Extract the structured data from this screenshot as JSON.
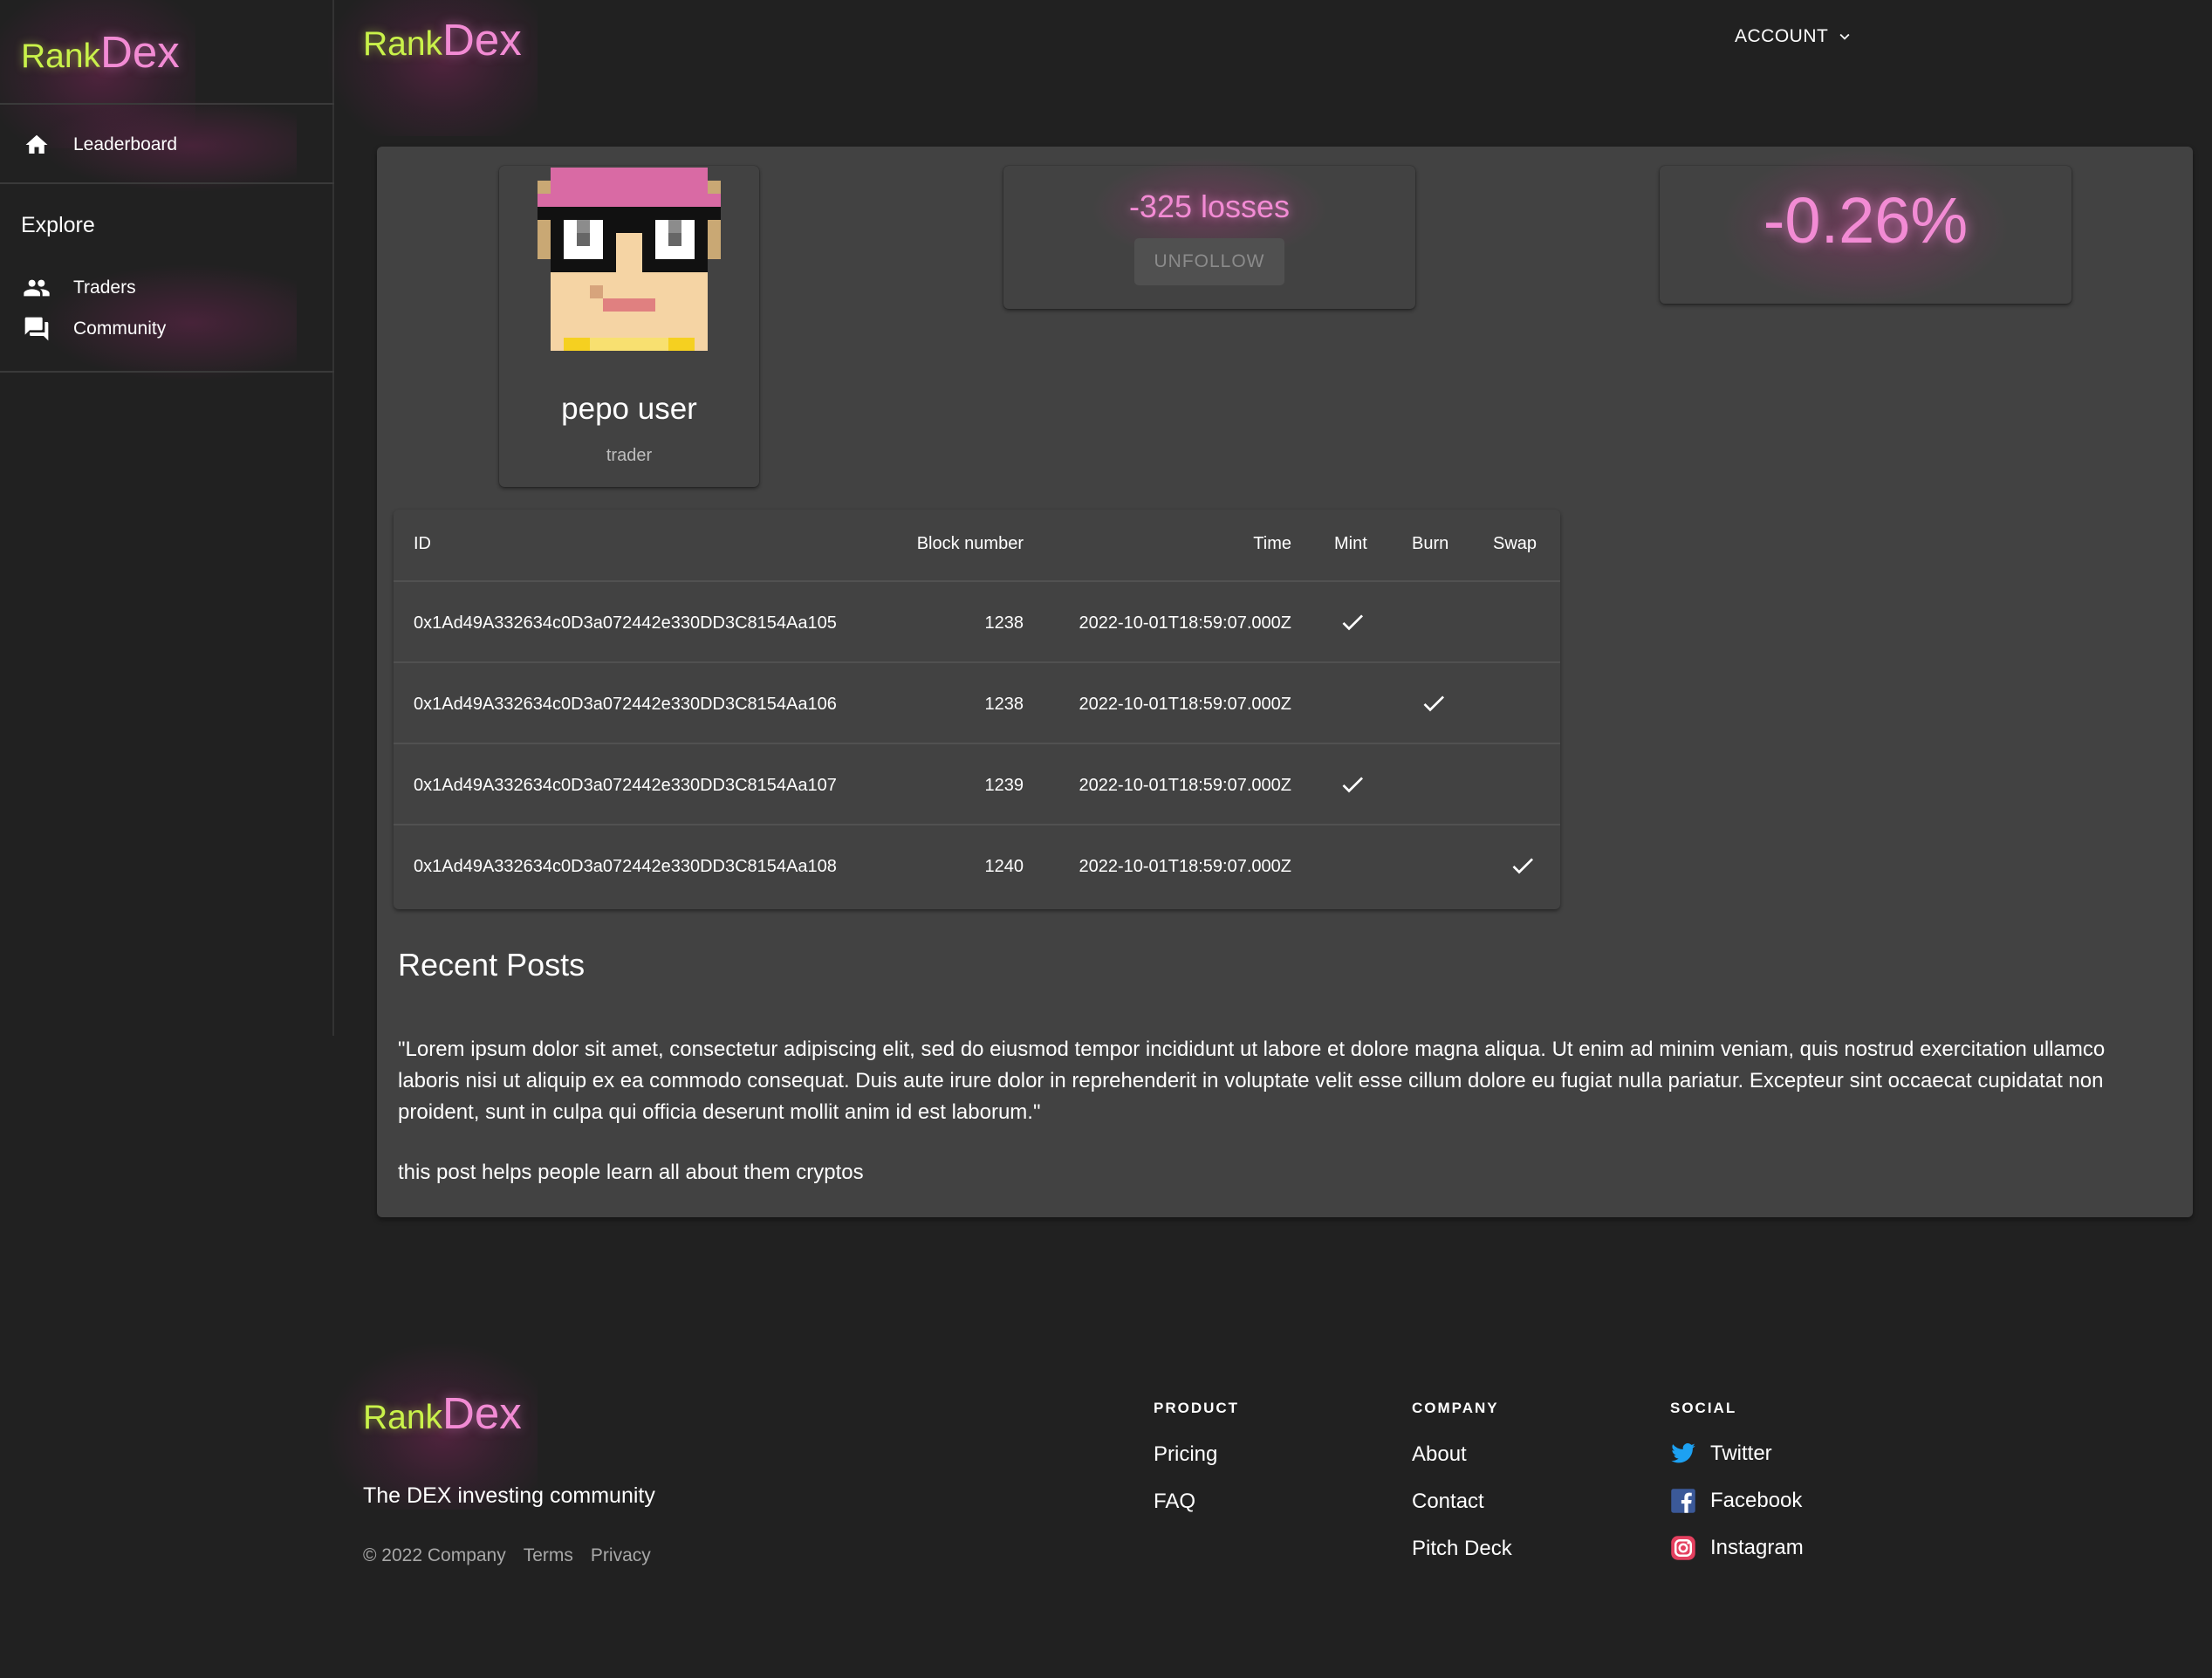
{
  "brand": {
    "rank": "Rank",
    "dex": "Dex"
  },
  "sidebar": {
    "items": [
      {
        "label": "Leaderboard",
        "icon": "home-icon"
      }
    ],
    "explore_title": "Explore",
    "explore_items": [
      {
        "label": "Traders",
        "icon": "people-icon"
      },
      {
        "label": "Community",
        "icon": "forum-icon"
      }
    ]
  },
  "header": {
    "account_label": "ACCOUNT"
  },
  "profile": {
    "name": "pepo user",
    "role": "trader"
  },
  "stats": {
    "losses": "-325 losses",
    "unfollow_label": "UNFOLLOW",
    "percent": "-0.26%"
  },
  "table": {
    "headers": {
      "id": "ID",
      "block": "Block number",
      "time": "Time",
      "mint": "Mint",
      "burn": "Burn",
      "swap": "Swap"
    },
    "rows": [
      {
        "id": "0x1Ad49A332634c0D3a072442e330DD3C8154Aa105",
        "block": "1238",
        "time": "2022-10-01T18:59:07.000Z",
        "type": "mint"
      },
      {
        "id": "0x1Ad49A332634c0D3a072442e330DD3C8154Aa106",
        "block": "1238",
        "time": "2022-10-01T18:59:07.000Z",
        "type": "burn"
      },
      {
        "id": "0x1Ad49A332634c0D3a072442e330DD3C8154Aa107",
        "block": "1239",
        "time": "2022-10-01T18:59:07.000Z",
        "type": "mint"
      },
      {
        "id": "0x1Ad49A332634c0D3a072442e330DD3C8154Aa108",
        "block": "1240",
        "time": "2022-10-01T18:59:07.000Z",
        "type": "swap"
      }
    ]
  },
  "posts": {
    "title": "Recent Posts",
    "items": [
      "\"Lorem ipsum dolor sit amet, consectetur adipiscing elit, sed do eiusmod tempor incididunt ut labore et dolore magna aliqua. Ut enim ad minim veniam, quis nostrud exercitation ullamco laboris nisi ut aliquip ex ea commodo consequat. Duis aute irure dolor in reprehenderit in voluptate velit esse cillum dolore eu fugiat nulla pariatur. Excepteur sint occaecat cupidatat non proident, sunt in culpa qui officia deserunt mollit anim id est laborum.\"",
      "this post helps people learn all about them cryptos"
    ]
  },
  "footer": {
    "tagline": "The DEX investing community",
    "copyright": "© 2022 Company",
    "terms": "Terms",
    "privacy": "Privacy",
    "columns": {
      "product": {
        "title": "PRODUCT",
        "links": [
          "Pricing",
          "FAQ"
        ]
      },
      "company": {
        "title": "COMPANY",
        "links": [
          "About",
          "Contact",
          "Pitch Deck"
        ]
      },
      "social": {
        "title": "SOCIAL",
        "links": [
          "Twitter",
          "Facebook",
          "Instagram"
        ]
      }
    }
  },
  "colors": {
    "background": "#212121",
    "surface": "#424242",
    "brand_green": "#c9f24a",
    "brand_pink": "#f28bd4",
    "twitter": "#1da1f2",
    "facebook": "#3b5998",
    "instagram": "#e4405f"
  }
}
